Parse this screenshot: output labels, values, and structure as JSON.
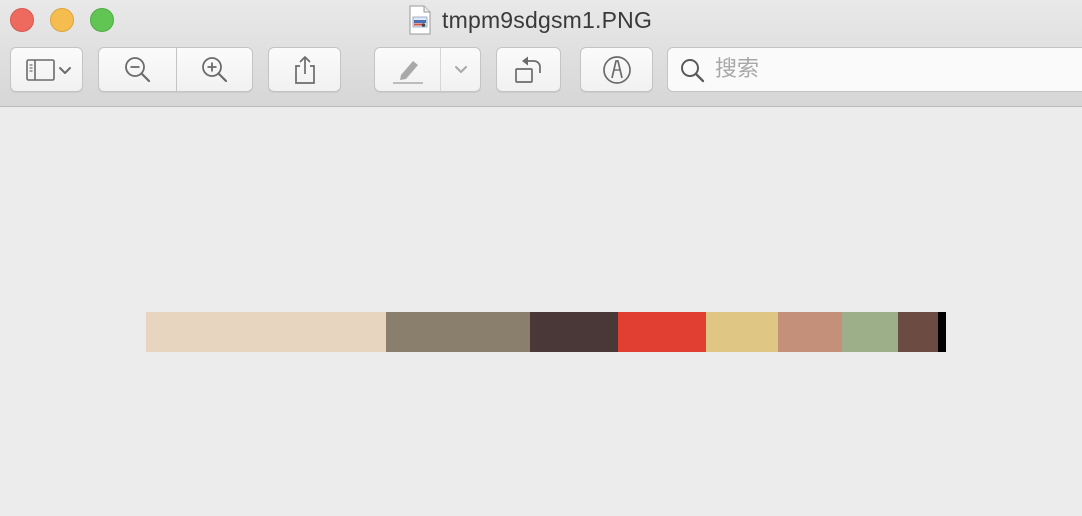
{
  "window": {
    "title": "tmpm9sdgsm1.PNG",
    "traffic_lights": {
      "close": "#ee6a5f",
      "minimize": "#f5bd4f",
      "maximize": "#61c554"
    }
  },
  "toolbar": {
    "buttons": [
      {
        "name": "sidebar-toggle-button",
        "icon": "sidebar-icon",
        "has_menu": true
      },
      {
        "name": "zoom-out-button",
        "icon": "zoom-out-icon"
      },
      {
        "name": "zoom-in-button",
        "icon": "zoom-in-icon"
      },
      {
        "name": "share-button",
        "icon": "share-icon"
      },
      {
        "name": "markup-button",
        "icon": "highlighter-icon",
        "has_menu": true,
        "disabled": true
      },
      {
        "name": "rotate-button",
        "icon": "rotate-left-icon"
      },
      {
        "name": "markup-toolbar-button",
        "icon": "pen-circle-icon"
      }
    ],
    "search": {
      "placeholder": "搜索",
      "value": ""
    }
  },
  "image": {
    "palette": [
      {
        "color": "#e8d5bf",
        "weight": 240
      },
      {
        "color": "#8a7f6c",
        "weight": 144
      },
      {
        "color": "#4a3738",
        "weight": 88
      },
      {
        "color": "#e23f33",
        "weight": 88
      },
      {
        "color": "#e0c685",
        "weight": 72
      },
      {
        "color": "#c49079",
        "weight": 64
      },
      {
        "color": "#9caf88",
        "weight": 56
      },
      {
        "color": "#6c4c42",
        "weight": 40
      },
      {
        "color": "#000000",
        "weight": 8
      }
    ]
  }
}
